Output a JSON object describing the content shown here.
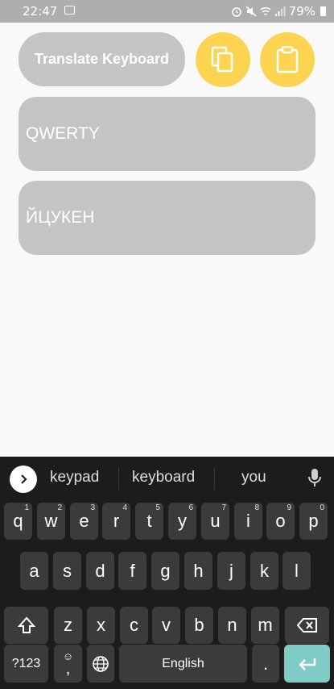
{
  "status_bar": {
    "time": "22:47",
    "battery": "79%"
  },
  "app": {
    "title": "Translate Keyboard",
    "layouts": [
      "QWERTY",
      "ЙЦУКЕН"
    ]
  },
  "keyboard": {
    "suggestions": [
      "keypad",
      "keyboard",
      "you"
    ],
    "row1": [
      {
        "k": "q",
        "h": "1"
      },
      {
        "k": "w",
        "h": "2"
      },
      {
        "k": "e",
        "h": "3"
      },
      {
        "k": "r",
        "h": "4"
      },
      {
        "k": "t",
        "h": "5"
      },
      {
        "k": "y",
        "h": "6"
      },
      {
        "k": "u",
        "h": "7"
      },
      {
        "k": "i",
        "h": "8"
      },
      {
        "k": "o",
        "h": "9"
      },
      {
        "k": "p",
        "h": "0"
      }
    ],
    "row2": [
      "a",
      "s",
      "d",
      "f",
      "g",
      "h",
      "j",
      "k",
      "l"
    ],
    "row3": [
      "z",
      "x",
      "c",
      "v",
      "b",
      "n",
      "m"
    ],
    "symbols_label": "?123",
    "comma": ",",
    "space_label": "English",
    "period": ".",
    "colors": {
      "enter": "#7fcbc6",
      "key": "#3b3b3b",
      "accent": "#fdd452"
    }
  }
}
